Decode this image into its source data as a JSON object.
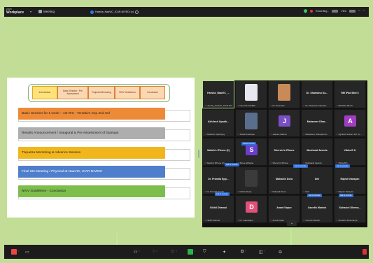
{
  "topbar": {
    "brand_line1": "zoom",
    "brand_line2": "Workplace",
    "meeting_label": "Meeting",
    "tab_title": "Harsha_NaaViC_ICAR-NIVEDI (o)",
    "recording_label": "Recording...",
    "view_label": "View"
  },
  "slide": {
    "nav": [
      "Introduction",
      "Basic Session / Pre Assessment",
      "Triquetra Mentoring",
      "NIVV Guidelines",
      "Conclusion"
    ],
    "rows": [
      {
        "text": "Basic Session for 1 week – 1st RIC - Tentative Sep 2nd 3rd",
        "color": "#ed8a37"
      },
      {
        "text": "Results Announcement / Inaugural & Pre Assessment of Startups",
        "color": "#aeaeae"
      },
      {
        "text": "Triquetra Mentoring & Advance Session",
        "color": "#f2b61d"
      },
      {
        "text": "Final SIC Meeting / Physical at NaaVIC, ICAR NIVEDI",
        "color": "#4f7fcc"
      },
      {
        "text": "NIVV Guidelines - Conclusion",
        "color": "#7cbd4c"
      }
    ]
  },
  "gallery": {
    "tiles": [
      {
        "name": "Harsha_NaaViC_...",
        "sub": "Harsha_NaaViC_ICAR NIVEDI",
        "active": true
      },
      {
        "name": "",
        "sub": "Naa VIC NIVEDI",
        "photo": "#e8e8f0"
      },
      {
        "name": "",
        "sub": "Dr. Dineshan",
        "photo": "#c98a5a"
      },
      {
        "name": "Dr. Shantanu Ka...",
        "sub": "Dr. Shantanu Kalambi..."
      },
      {
        "name": "RM iPad Mini 6",
        "sub": "RM iPad Mini 6"
      },
      {
        "name": "Akhilesh Upadh...",
        "sub": "Akhilesh Upadhyay"
      },
      {
        "name": "",
        "sub": "Sidhal Kedariya",
        "photo": "#5a6e8e"
      },
      {
        "name": "J",
        "sub": "Jaanee Nawret",
        "avatar": "#7a4fc4"
      },
      {
        "name": "Mahaveer Dhar...",
        "sub": "Mahaveer Dharapuram"
      },
      {
        "name": "A",
        "sub": "Agrilotic Solvers Pvt. Lt...",
        "avatar": "#a03ec0"
      },
      {
        "name": "Satish's iPhone (2)",
        "sub": "Satish's iPhone (2)"
      },
      {
        "name": "S",
        "sub": "Shree abhigna",
        "avatar": "#6a3ec8"
      },
      {
        "name": "Shervin's iPhone",
        "sub": "Shervin's iPhone"
      },
      {
        "name": "Musharaf Javeria",
        "sub": "Musharaf Javeria"
      },
      {
        "name": "Vibha B K",
        "sub": "Vibha B K"
      },
      {
        "name": "Dr. Pramila Epp...",
        "sub": "Dr. Pramila Eppah"
      },
      {
        "name": "",
        "sub": "Mohit Shetty",
        "photo": "#3b3b3b"
      },
      {
        "name": "Mahanth Dora",
        "sub": "Mahanth Dora"
      },
      {
        "name": "Dell",
        "sub": "Dell"
      },
      {
        "name": "Rajesh Narayan",
        "sub": "Rajesh Narayan"
      },
      {
        "name": "Nikhil Dhamal",
        "sub": "Nikhil Dhamal"
      },
      {
        "name": "D",
        "sub": "Dr. Lokeshjie's",
        "avatar": "#e0517a"
      },
      {
        "name": "Anant Kapur",
        "sub": "Anant Kapur"
      },
      {
        "name": "Ozonfix Manish",
        "sub": "Ozonfix Manish"
      },
      {
        "name": "Suhasini Dhema...",
        "sub": "Suhasini Dhemanya"
      }
    ],
    "badges": [
      "Ask to unmute",
      "Ask to unmute",
      "Ask to unmute",
      "Ask to unmute",
      "Ask to unmute",
      "Ask to unmute",
      "Ask to unmute"
    ]
  },
  "colors": {
    "frame": "#c3dc98",
    "app_bg": "#1c1c1c",
    "accent_blue": "#2f6fd6",
    "muted_red": "#e33333"
  }
}
